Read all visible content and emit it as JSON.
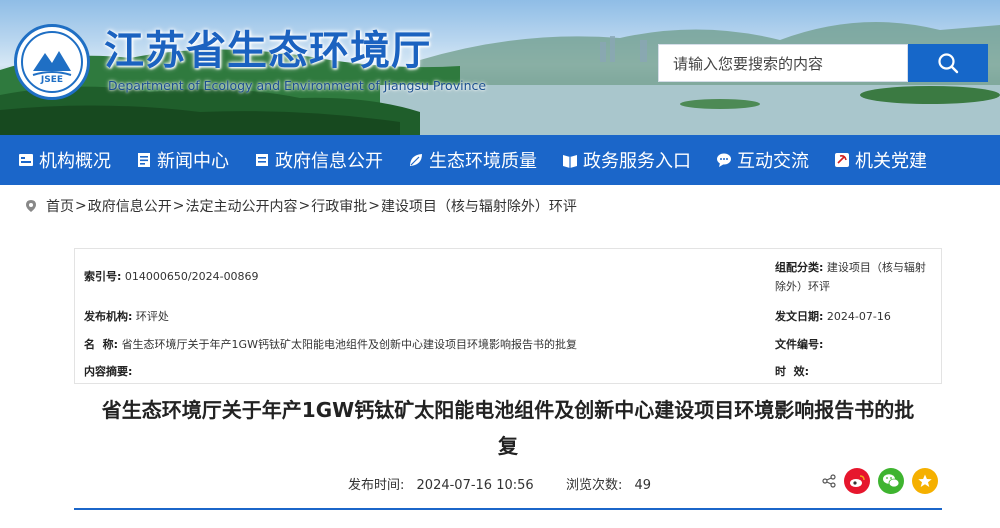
{
  "header": {
    "title": "江苏省生态环境厅",
    "subtitle": "Department of Ecology and Environment of Jiangsu Province",
    "logo_text": "JSEE",
    "search_placeholder": "请输入您要搜索的内容"
  },
  "nav": {
    "items": [
      {
        "label": "机构概况",
        "icon": "org-icon"
      },
      {
        "label": "新闻中心",
        "icon": "news-icon"
      },
      {
        "label": "政府信息公开",
        "icon": "info-open-icon"
      },
      {
        "label": "生态环境质量",
        "icon": "leaf-icon"
      },
      {
        "label": "政务服务入口",
        "icon": "service-icon"
      },
      {
        "label": "互动交流",
        "icon": "chat-icon"
      },
      {
        "label": "机关党建",
        "icon": "party-icon"
      }
    ]
  },
  "breadcrumb": {
    "items": [
      "首页",
      "政府信息公开",
      "法定主动公开内容",
      "行政审批",
      "建设项目（核与辐射除外）环评"
    ],
    "separator": ">"
  },
  "info": {
    "index_label": "索引号:",
    "index_value": "014000650/2024-00869",
    "category_label": "组配分类:",
    "category_value_line1": "建设项目（核与辐射",
    "category_value_line2": "除外）环评",
    "publisher_label": "发布机构:",
    "publisher_value": "环评处",
    "date_label": "发文日期:",
    "date_value": "2024-07-16",
    "name_label": "名  称:",
    "name_value": "省生态环境厅关于年产1GW钙钛矿太阳能电池组件及创新中心建设项目环境影响报告书的批复",
    "docno_label": "文件编号:",
    "docno_value": "",
    "summary_label": "内容摘要:",
    "summary_value": "",
    "validity_label": "时  效:",
    "validity_value": ""
  },
  "article": {
    "title_line1": "省生态环境厅关于年产1GW钙钛矿太阳能电池组件及创新中心建设项目环境影响报告书的批",
    "title_line2": "复",
    "publish_time_label": "发布时间:",
    "publish_time_value": "2024-07-16 10:56",
    "views_label": "浏览次数:",
    "views_value": "49"
  },
  "colors": {
    "primary": "#1b66c9",
    "weibo": "#e6162d",
    "wechat": "#3fb430",
    "favorite": "#f5b000"
  }
}
